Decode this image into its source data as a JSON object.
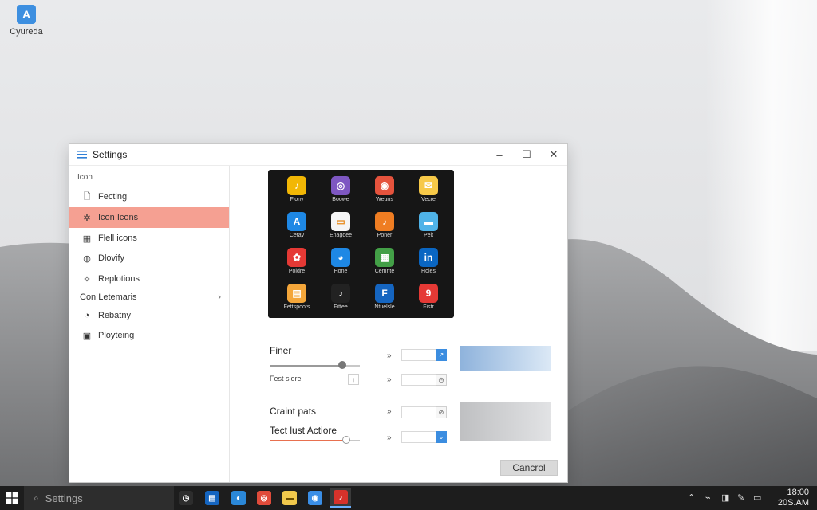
{
  "desktop": {
    "icon": {
      "label": "Cyureda",
      "glyph": "A",
      "icon": "app-icon",
      "color": "#3d8fe0"
    }
  },
  "window": {
    "title": "Settings",
    "controls": {
      "minimize": "–",
      "maximize": "☐",
      "close": "✕"
    }
  },
  "sidebar": {
    "heading": "Icon",
    "items": [
      {
        "label": "Fecting",
        "icon": "page-icon",
        "glyph": "🗋"
      },
      {
        "label": "Icon Icons",
        "icon": "puzzle-icon",
        "glyph": "✲",
        "active": true
      },
      {
        "label": "Flell icons",
        "icon": "grid-icon",
        "glyph": "▦"
      },
      {
        "label": "Dlovify",
        "icon": "globe-icon",
        "glyph": "◍"
      },
      {
        "label": "Replotions",
        "icon": "pin-icon",
        "glyph": "✧"
      },
      {
        "label": "Con Letemaris",
        "group": true,
        "chevron": "›"
      },
      {
        "label": "Rebatny",
        "icon": "clock-icon",
        "glyph": "◔"
      },
      {
        "label": "Ployteing",
        "icon": "image-icon",
        "glyph": "▣"
      }
    ]
  },
  "icon_grid": [
    {
      "label": "Flony",
      "color": "#f2b705",
      "glyph": "♪"
    },
    {
      "label": "Boowe",
      "color": "#7e57c2",
      "glyph": "◎"
    },
    {
      "label": "Weuns",
      "color": "#e5533d",
      "glyph": "◉"
    },
    {
      "label": "Vecre",
      "color": "#f7c948",
      "glyph": "✉"
    },
    {
      "label": "Cetay",
      "color": "#1e88e5",
      "glyph": "A"
    },
    {
      "label": "Enagdee",
      "color": "#f5f5f5",
      "glyph": "▭"
    },
    {
      "label": "Poner",
      "color": "#ef7d22",
      "glyph": "♪"
    },
    {
      "label": "Pelt",
      "color": "#4fb3e8",
      "glyph": "▬"
    },
    {
      "label": "Poidre",
      "color": "#e53935",
      "glyph": "✿"
    },
    {
      "label": "Hone",
      "color": "#1e88e5",
      "glyph": "◕"
    },
    {
      "label": "Cemnte",
      "color": "#43a047",
      "glyph": "▦"
    },
    {
      "label": "Holes",
      "color": "#0a66c2",
      "glyph": "in"
    },
    {
      "label": "Fettspoots",
      "color": "#f4a63a",
      "glyph": "▤"
    },
    {
      "label": "Fittee",
      "color": "#222222",
      "glyph": "♪"
    },
    {
      "label": "Ntuelsle",
      "color": "#1565c0",
      "glyph": "F"
    },
    {
      "label": "Fistr",
      "color": "#e53935",
      "glyph": "9"
    }
  ],
  "controls": {
    "finer": {
      "label": "Finer",
      "level": 0.8,
      "arrows": "»",
      "button_icon": "↗"
    },
    "font_size": {
      "label": "Fest siore",
      "button": "↑",
      "arrows": "»",
      "button_icon": "◷"
    },
    "crafting": {
      "label": "Craint pats",
      "arrows": "»",
      "button_icon": "⊘"
    },
    "text_action": {
      "label": "Tect lust Actiore",
      "level": 0.85,
      "arrows": "»",
      "button_icon": "⌄"
    }
  },
  "cancel_label": "Cancrol",
  "taskbar": {
    "search_text": "Settings",
    "search_icon": "⌕",
    "apps": [
      {
        "icon": "clock-app-icon",
        "color": "#2d2d2d",
        "glyph": "◷"
      },
      {
        "icon": "windows-app-icon",
        "color": "#1565c0",
        "glyph": "▤"
      },
      {
        "icon": "edge-app-icon",
        "color": "#2b88d8",
        "glyph": "◐"
      },
      {
        "icon": "chrome-app-icon",
        "color": "#e04b3a",
        "glyph": "◎"
      },
      {
        "icon": "folder-app-icon",
        "color": "#f2c94c",
        "glyph": "▬"
      },
      {
        "icon": "browser-app-icon",
        "color": "#3a8ee6",
        "glyph": "◉"
      },
      {
        "icon": "music-app-icon",
        "color": "#d7322b",
        "glyph": "♪"
      }
    ],
    "tray": [
      "⌃",
      "⌁",
      "◨",
      "✎",
      "▭"
    ],
    "time": "18:00",
    "date": "20S.AM"
  }
}
